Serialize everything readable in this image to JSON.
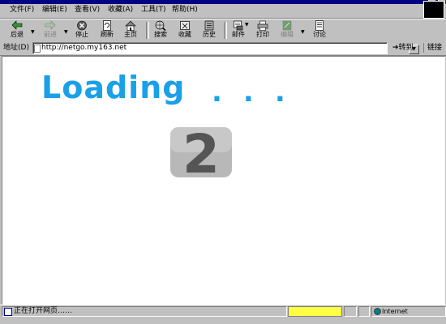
{
  "menu": {
    "items": [
      {
        "label": "文件(F)"
      },
      {
        "label": "编辑(E)"
      },
      {
        "label": "查看(V)"
      },
      {
        "label": "收藏(A)"
      },
      {
        "label": "工具(T)"
      },
      {
        "label": "帮助(H)"
      }
    ]
  },
  "toolbar": {
    "buttons": [
      {
        "label": "后退",
        "icon": "back-arrow-icon",
        "enabled": true
      },
      {
        "label": "前进",
        "icon": "forward-arrow-icon",
        "enabled": false
      },
      {
        "label": "停止",
        "icon": "stop-icon",
        "enabled": true
      },
      {
        "label": "刷新",
        "icon": "refresh-icon",
        "enabled": true
      },
      {
        "label": "主页",
        "icon": "home-icon",
        "enabled": true
      },
      {
        "label": "搜索",
        "icon": "search-globe-icon",
        "enabled": true
      },
      {
        "label": "收藏",
        "icon": "favorites-icon",
        "enabled": true
      },
      {
        "label": "历史",
        "icon": "history-icon",
        "enabled": true
      },
      {
        "label": "邮件",
        "icon": "mail-icon",
        "enabled": true
      },
      {
        "label": "打印",
        "icon": "printer-icon",
        "enabled": true
      },
      {
        "label": "编辑",
        "icon": "edit-icon",
        "enabled": false
      },
      {
        "label": "讨论",
        "icon": "discuss-icon",
        "enabled": true
      }
    ]
  },
  "address": {
    "label": "地址(D)",
    "url": "http://netgo.my163.net",
    "go_label": "转到",
    "links_label": "链接"
  },
  "content": {
    "loading_text": "Loading",
    "dots": "...",
    "big_number": "2"
  },
  "status": {
    "text": "正在打开网页……",
    "zone": "Internet"
  },
  "colors": {
    "loading": "#1aa0e8",
    "chrome": "#c0c0c0",
    "desktop": "#008080",
    "progress": "#ffff44"
  }
}
